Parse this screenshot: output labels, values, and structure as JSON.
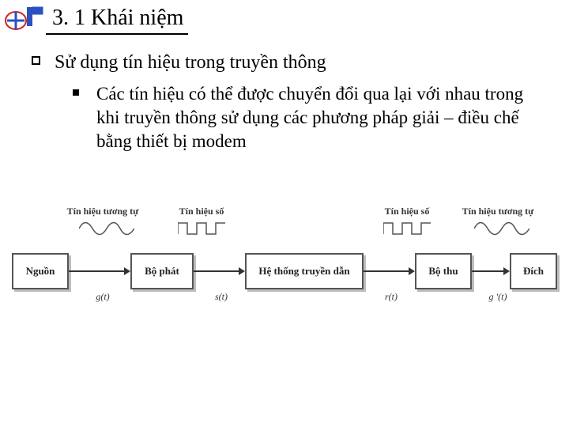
{
  "header": {
    "title": "3. 1 Khái niệm",
    "logo_name": "logo"
  },
  "bullets": {
    "lvl1": "Sử dụng tín hiệu trong truyền thông",
    "lvl2": "Các tín hiệu có thể được chuyển đổi qua lại với nhau trong khi truyền thông sử dụng các phương pháp giải – điều chế bằng thiết bị modem"
  },
  "diagram": {
    "boxes": {
      "source": "Nguồn",
      "transmitter": "Bộ phát",
      "channel": "Hệ thống truyền dẫn",
      "receiver": "Bộ thu",
      "destination": "Đích"
    },
    "signal_labels": {
      "analog1": "Tín hiệu tương tự",
      "digital1": "Tín hiệu số",
      "digital2": "Tín hiệu số",
      "analog2": "Tín hiệu tương tự"
    },
    "below_labels": {
      "g": "g(t)",
      "s": "s(t)",
      "r": "r(t)",
      "gprime": "g '(t)"
    }
  }
}
